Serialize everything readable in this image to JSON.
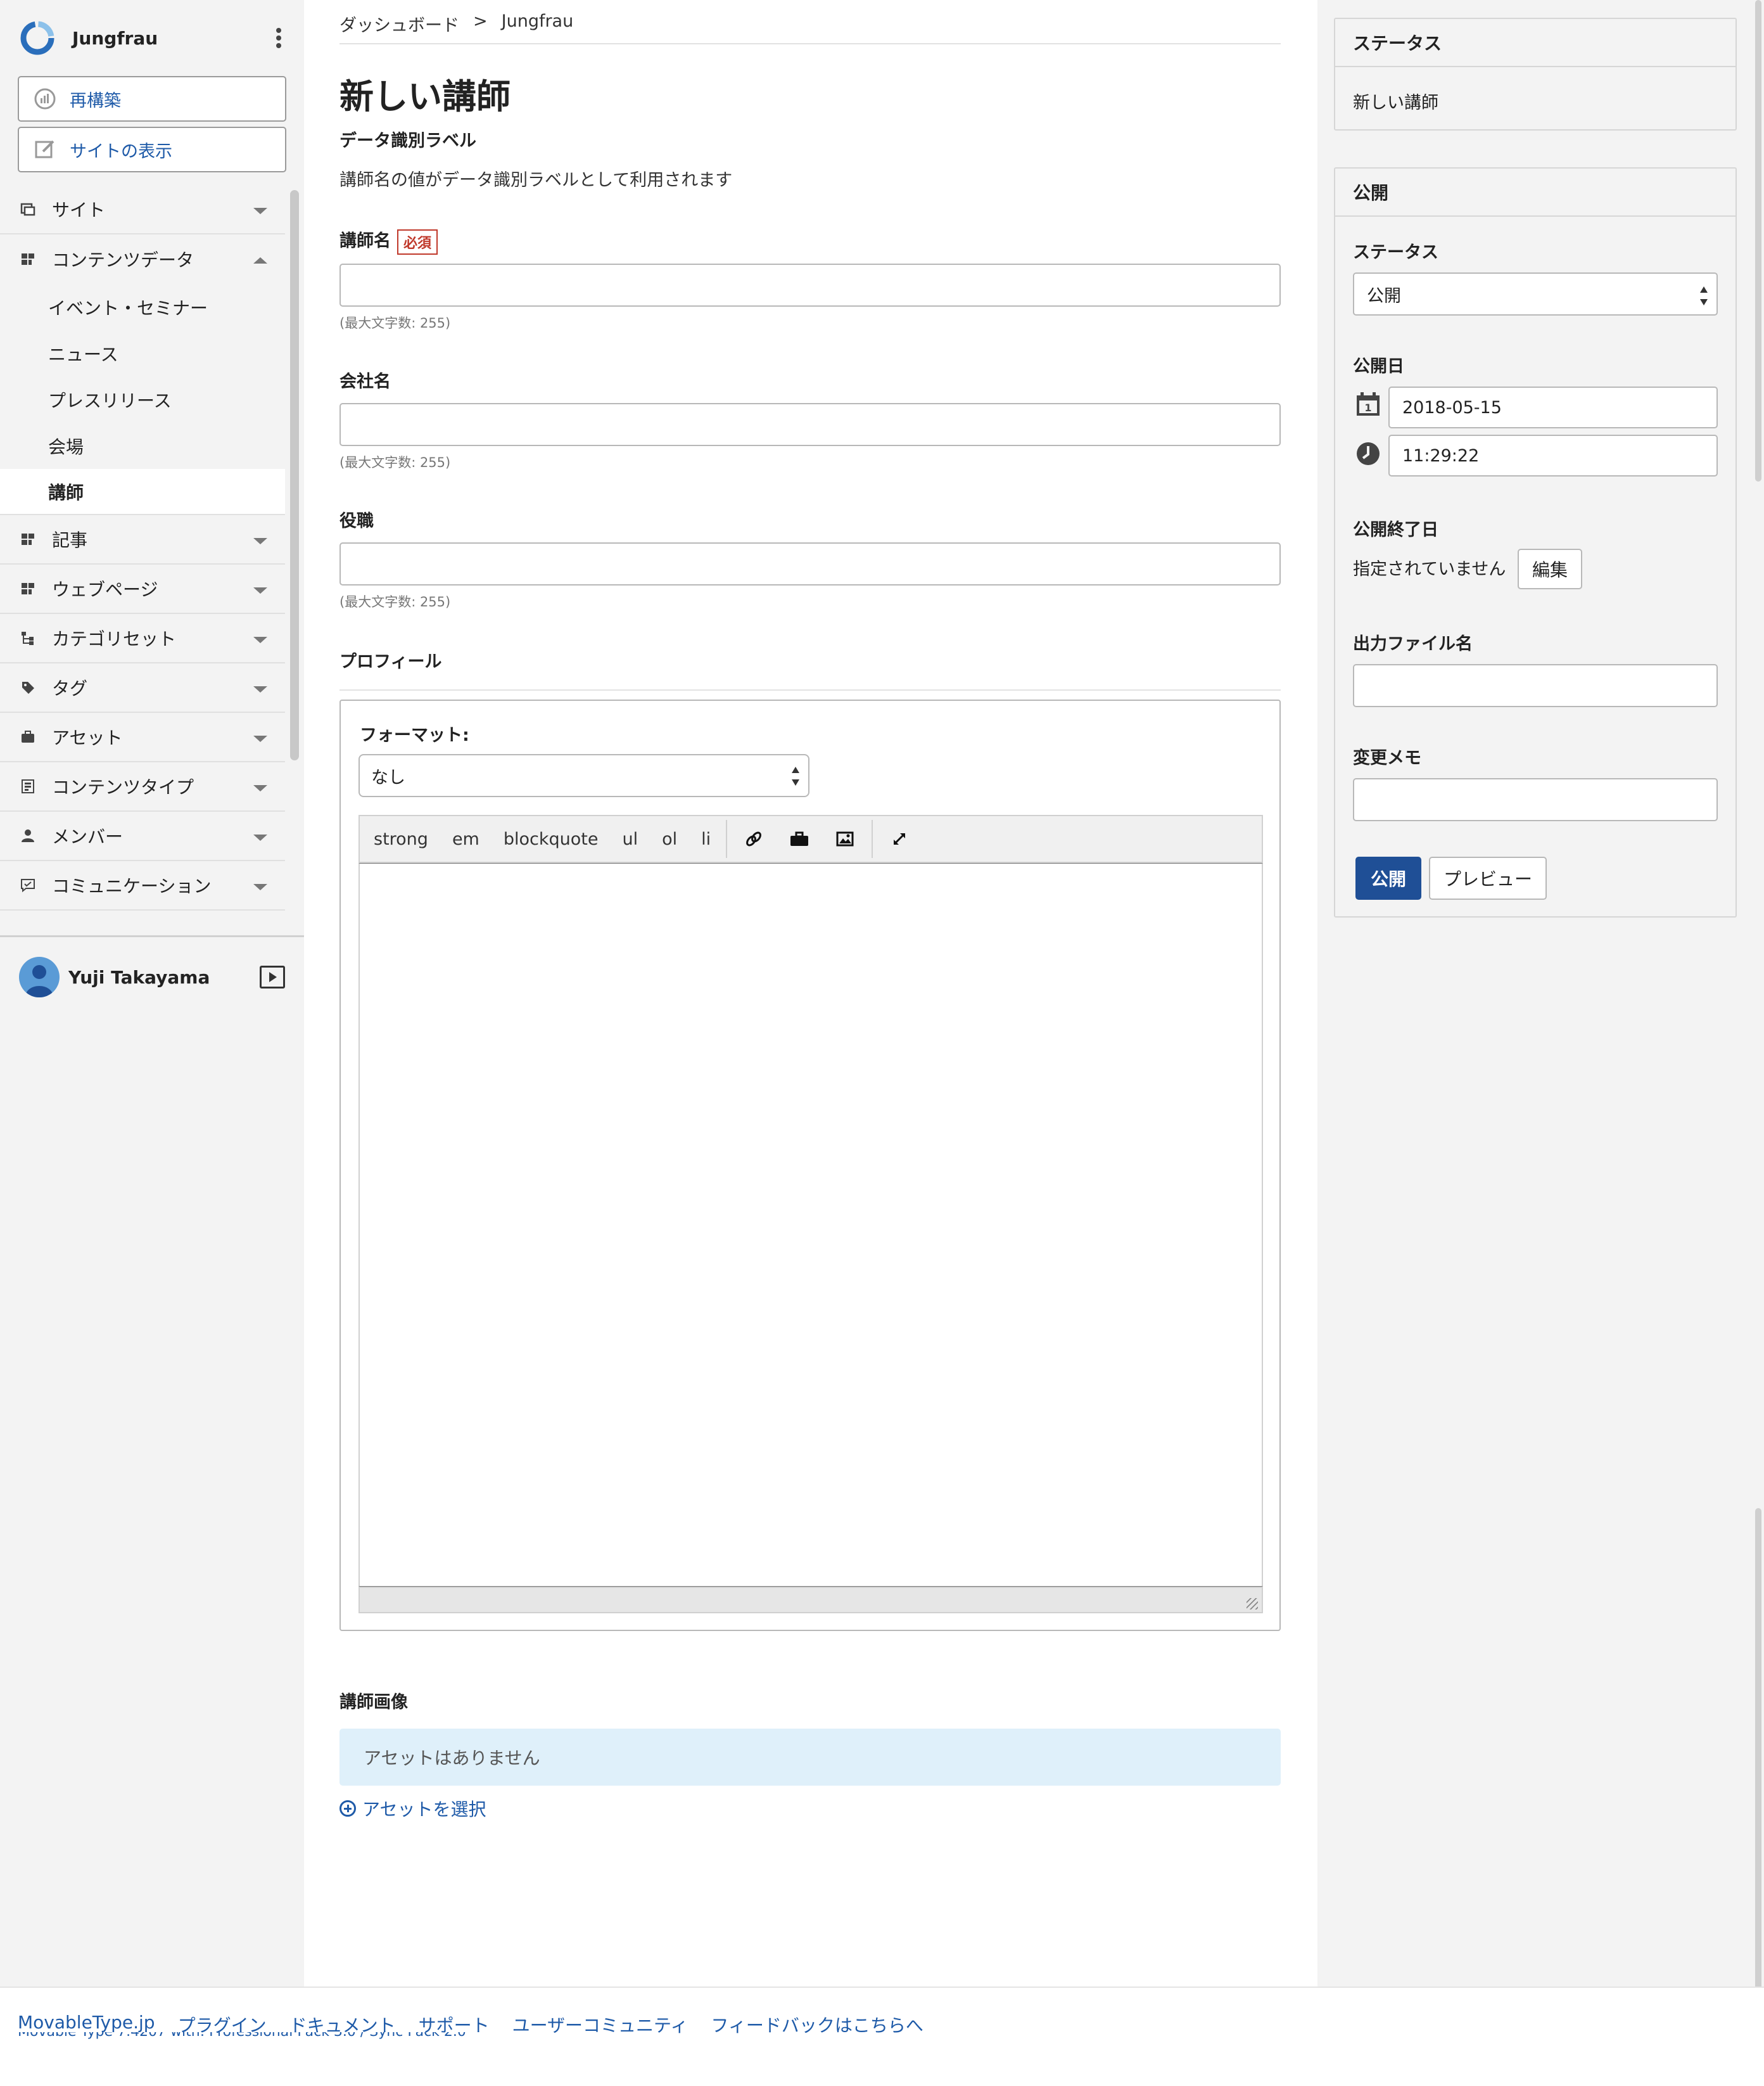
{
  "site": {
    "name": "Jungfrau"
  },
  "sidebar": {
    "rebuild_label": "再構築",
    "view_site_label": "サイトの表示",
    "nav": {
      "site": "サイト",
      "content_data": "コンテンツデータ",
      "content_data_items": [
        "イベント・セミナー",
        "ニュース",
        "プレスリリース",
        "会場",
        "講師"
      ],
      "entries": "記事",
      "pages": "ウェブページ",
      "category_sets": "カテゴリセット",
      "tags": "タグ",
      "assets": "アセット",
      "content_types": "コンテンツタイプ",
      "members": "メンバー",
      "communication": "コミュニケーション"
    },
    "user": {
      "name": "Yuji Takayama"
    }
  },
  "breadcrumb": {
    "home": "ダッシュボード",
    "sep": ">",
    "current": "Jungfrau"
  },
  "main": {
    "title": "新しい講師",
    "data_label_heading": "データ識別ラベル",
    "data_label_desc": "講師名の値がデータ識別ラベルとして利用されます",
    "required_badge": "必須",
    "fields": {
      "instructor_name": {
        "label": "講師名",
        "value": "",
        "hint": "(最大文字数: 255)"
      },
      "company": {
        "label": "会社名",
        "value": "",
        "hint": "(最大文字数: 255)"
      },
      "position": {
        "label": "役職",
        "value": "",
        "hint": "(最大文字数: 255)"
      }
    },
    "profile": {
      "label": "プロフィール",
      "format_label": "フォーマット:",
      "format_value": "なし",
      "toolbar": [
        "strong",
        "em",
        "blockquote",
        "ul",
        "ol",
        "li"
      ],
      "toolbar_icons": [
        "link-icon",
        "asset-icon",
        "image-icon",
        "fullscreen-icon"
      ]
    },
    "image": {
      "label": "講師画像",
      "empty_text": "アセットはありません",
      "select_label": "アセットを選択"
    }
  },
  "right": {
    "status_panel": {
      "title": "ステータス",
      "value": "新しい講師"
    },
    "publish_panel": {
      "title": "公開",
      "status_label": "ステータス",
      "status_value": "公開",
      "date_label": "公開日",
      "date_value": "2018-05-15",
      "time_value": "11:29:22",
      "end_label": "公開終了日",
      "end_value": "指定されていません",
      "edit_label": "編集",
      "filename_label": "出力ファイル名",
      "filename_value": "",
      "memo_label": "変更メモ",
      "memo_value": "",
      "publish_button": "公開",
      "preview_button": "プレビュー"
    }
  },
  "footer": {
    "links": [
      "MovableType.jp",
      "プラグイン",
      "ドキュメント",
      "サポート",
      "ユーザーコミュニティ",
      "フィードバックはこちらへ"
    ],
    "version": "Movable Type 7.4207 with: Professional Pack 3.0 / Sync Pack 2.0"
  },
  "colors": {
    "accent": "#1f4f96",
    "link": "#1e5aa8",
    "required": "#c0392b",
    "info_bg": "#dff0fa"
  }
}
